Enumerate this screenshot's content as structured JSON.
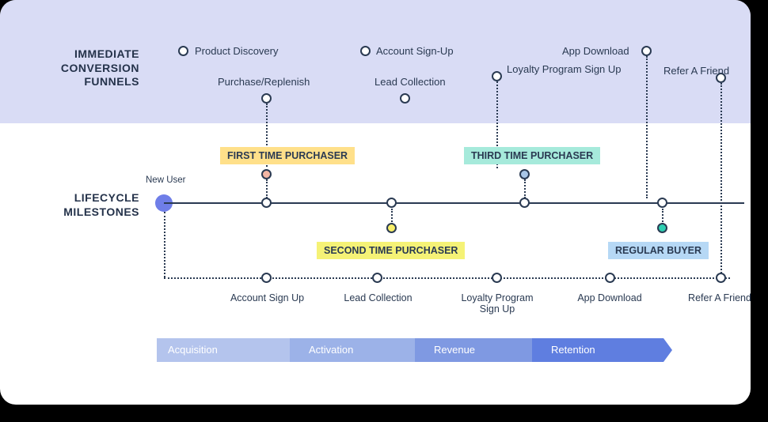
{
  "sections": {
    "funnels_title": "IMMEDIATE CONVERSION FUNNELS",
    "milestones_title": "LIFECYCLE MILESTONES"
  },
  "funnels": {
    "product_discovery": "Product Discovery",
    "account_signup": "Account Sign-Up",
    "app_download": "App Download",
    "purchase_replenish": "Purchase/Replenish",
    "lead_collection": "Lead Collection",
    "loyalty_program": "Loyalty Program Sign Up",
    "refer_friend": "Refer A Friend"
  },
  "lifecycle": {
    "new_user": "New User",
    "first_time": "FIRST TIME PURCHASER",
    "second_time": "SECOND TIME PURCHASER",
    "third_time": "THIRD TIME PURCHASER",
    "regular_buyer": "REGULAR BUYER"
  },
  "bottom_steps": {
    "account_signup": "Account Sign Up",
    "lead_collection": "Lead Collection",
    "loyalty_program": "Loyalty Program Sign Up",
    "app_download": "App Download",
    "refer_friend": "Refer A Friend"
  },
  "stages": {
    "acquisition": "Acquisition",
    "activation": "Activation",
    "revenue": "Revenue",
    "retention": "Retention"
  }
}
